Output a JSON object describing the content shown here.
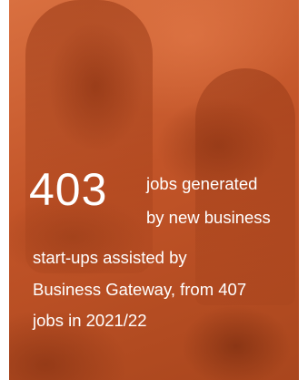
{
  "stat": {
    "number": "403",
    "lines": [
      "jobs generated",
      "by new business",
      "start-ups assisted by",
      "Business Gateway, from 407",
      "jobs in 2021/22"
    ]
  },
  "colors": {
    "overlay": "#c85a2a",
    "text": "#ffffff"
  }
}
